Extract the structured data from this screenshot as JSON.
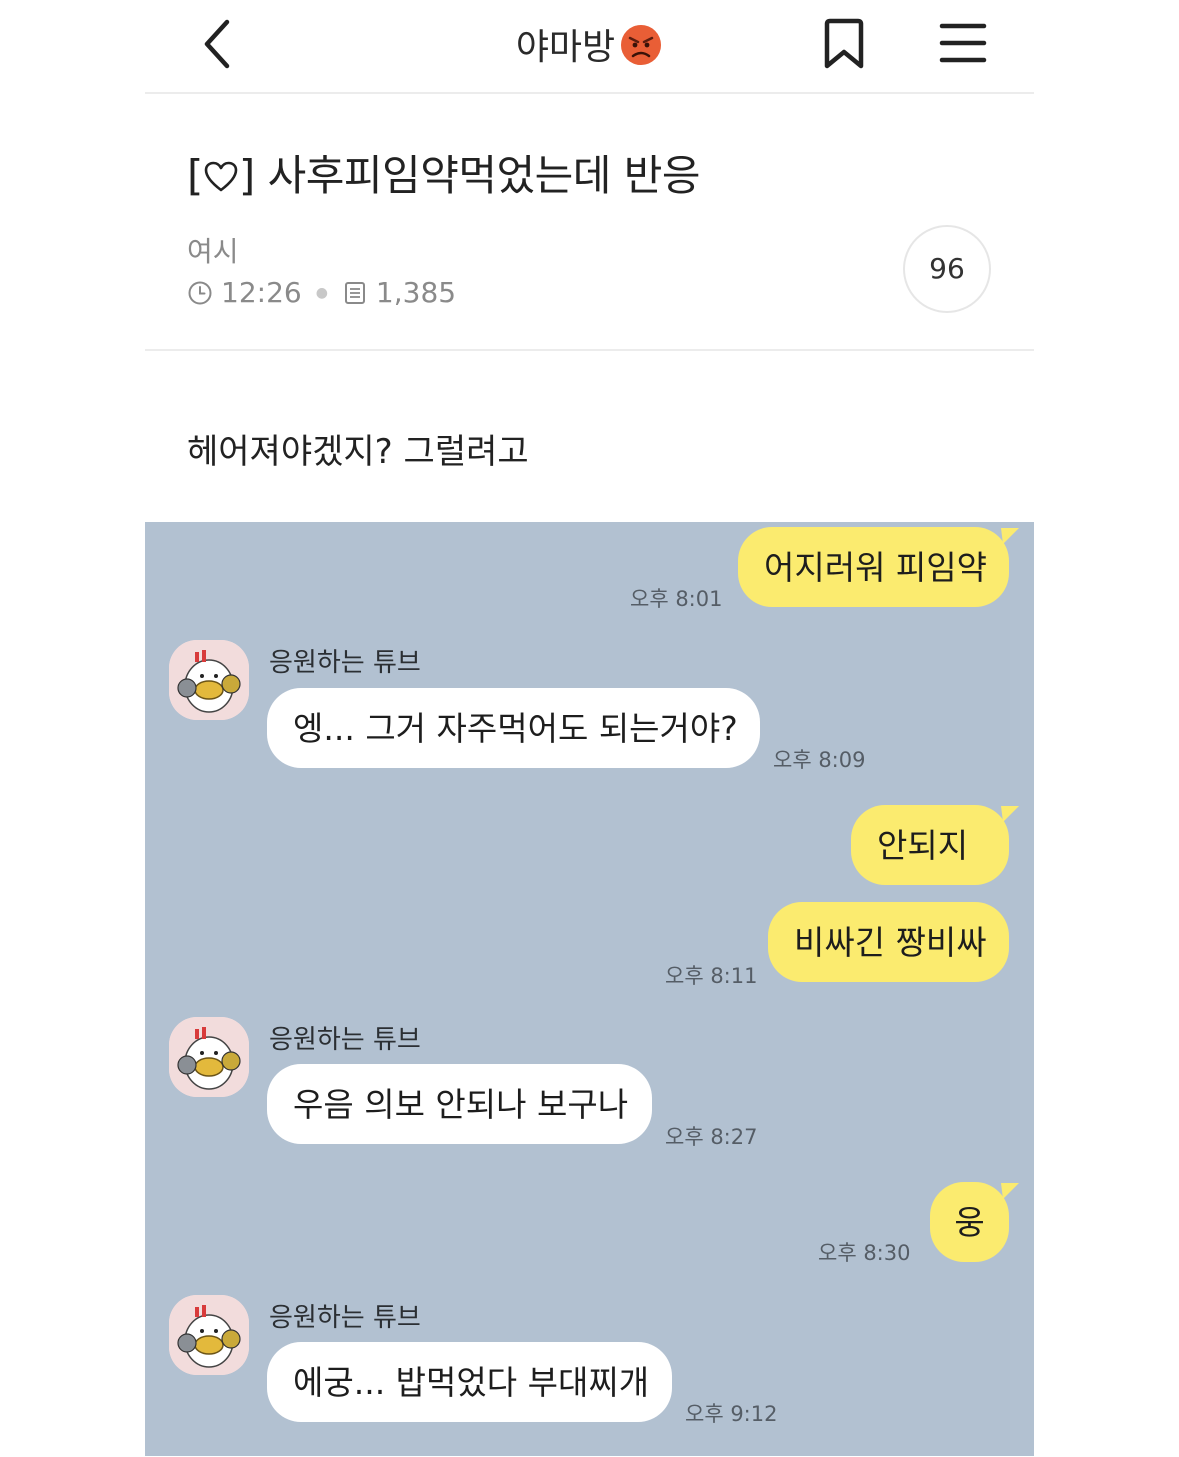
{
  "header": {
    "title": "야마방",
    "title_emoji": "angry-face-icon"
  },
  "post": {
    "title": "사후피임약먹었는데 반응",
    "title_prefix_open": "[",
    "title_prefix_close": "]",
    "author": "여시",
    "time": "12:26",
    "views": "1,385",
    "comment_count": "96",
    "body": "헤어져야겠지? 그럴려고"
  },
  "chat": {
    "background": "#b2c1d1",
    "mine_color": "#fbeb6f",
    "messages": [
      {
        "from": "me",
        "text": "어지러워 피임약",
        "time": "오후 8:01"
      },
      {
        "from": "other",
        "sender": "응원하는 튜브",
        "text": "엥... 그거 자주먹어도 되는거야?",
        "time": "오후 8:09"
      },
      {
        "from": "me",
        "text": "안되지",
        "time": ""
      },
      {
        "from": "me",
        "text": "비싸긴 짱비싸",
        "time": "오후 8:11"
      },
      {
        "from": "other",
        "sender": "응원하는 튜브",
        "text": "우음 의보 안되나 보구나",
        "time": "오후 8:27"
      },
      {
        "from": "me",
        "text": "웅",
        "time": "오후 8:30"
      },
      {
        "from": "other",
        "sender": "응원하는 튜브",
        "text": "에궁... 밥먹었다 부대찌개",
        "time": "오후 9:12"
      }
    ]
  }
}
